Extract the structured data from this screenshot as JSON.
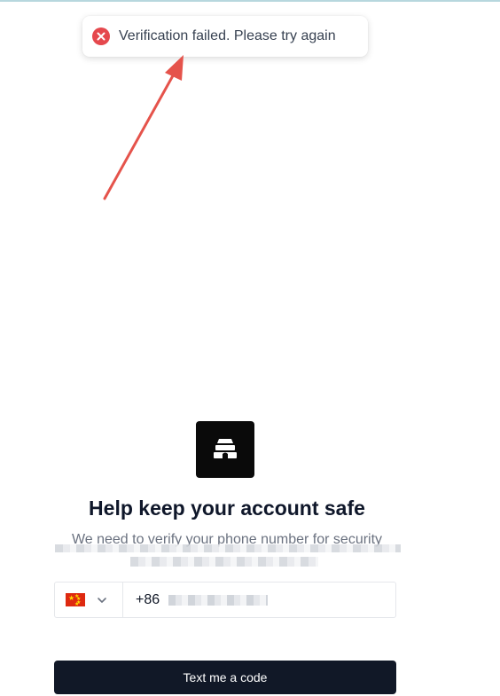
{
  "toast": {
    "message": "Verification failed. Please try again",
    "icon": "error-circle-icon",
    "icon_color": "#e5484d"
  },
  "annotation": {
    "arrow_color": "#e5534b"
  },
  "brand": {
    "logo_icon": "beehive-icon",
    "logo_bg": "#0a0a0a"
  },
  "main": {
    "title": "Help keep your account safe",
    "subtitle": "We need to verify your phone number for security"
  },
  "phone": {
    "country_flag": "china-flag",
    "dial_code": "+86"
  },
  "actions": {
    "submit_label": "Text me a code",
    "submit_color": "#111827"
  }
}
